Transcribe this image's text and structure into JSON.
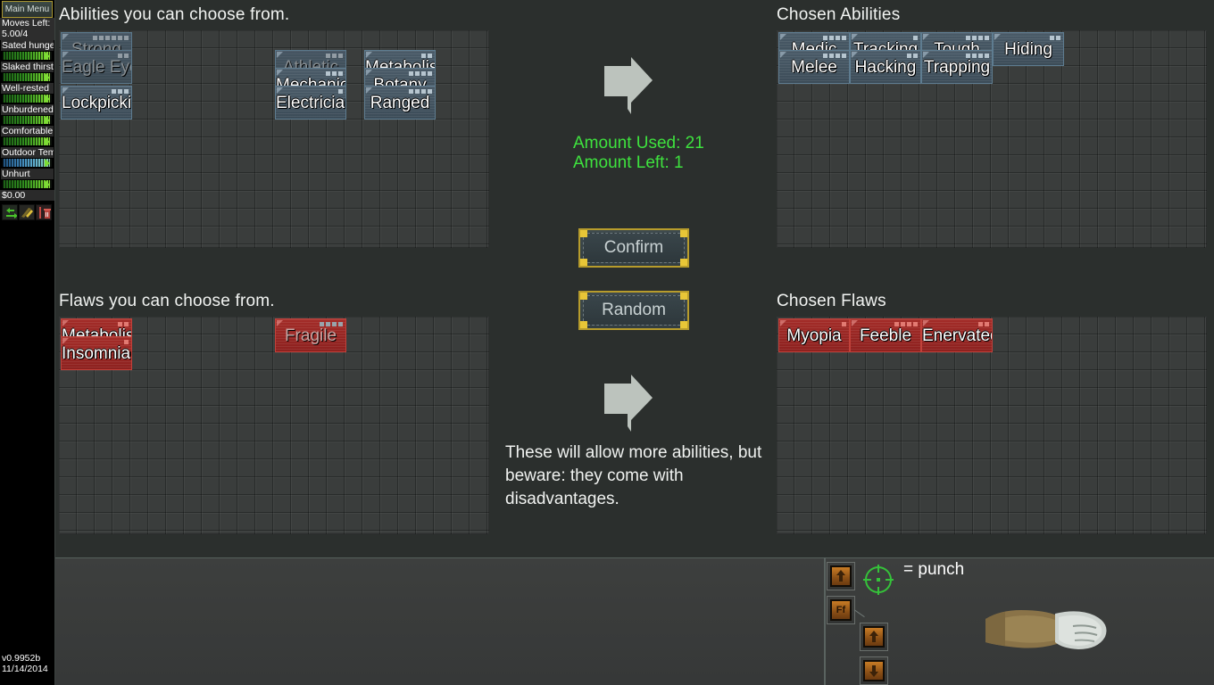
{
  "sidebar": {
    "menu_button": "Main Menu",
    "moves_label": "Moves Left:",
    "moves_value": "5.00/4",
    "stats": [
      {
        "label": "Sated hunge",
        "fill": 96,
        "type": "green"
      },
      {
        "label": "Slaked thirst",
        "fill": 96,
        "type": "green"
      },
      {
        "label": "Well-rested",
        "fill": 96,
        "type": "green"
      },
      {
        "label": "Unburdened",
        "fill": 96,
        "type": "green"
      },
      {
        "label": "Comfortable",
        "fill": 96,
        "type": "green"
      },
      {
        "label": "Outdoor Tem",
        "fill": 96,
        "type": "blue"
      },
      {
        "label": "Unhurt",
        "fill": 96,
        "type": "green"
      }
    ],
    "money": "$0.00",
    "icons": [
      "move-arrows-icon",
      "lightning-bolt-icon",
      "trash-can-icon"
    ],
    "version": "v0.9952b",
    "date": "11/14/2014"
  },
  "abilities_pool": {
    "heading": "Abilities you can choose from.",
    "items": [
      {
        "label": "Strong",
        "col": 0,
        "row": 0,
        "cost": 6,
        "disabled": true
      },
      {
        "label": "Eagle Eye",
        "col": 0,
        "row": 1,
        "cost": 2,
        "disabled": true
      },
      {
        "label": "Lockpicking",
        "col": 0,
        "row": 3,
        "cost": 3,
        "disabled": false
      },
      {
        "label": "Athletic",
        "col": 12,
        "row": 1,
        "cost": 3,
        "disabled": true
      },
      {
        "label": "Metabolism",
        "col": 17,
        "row": 1,
        "cost": 2,
        "disabled": false
      },
      {
        "label": "Mechanic",
        "col": 12,
        "row": 2,
        "cost": 3,
        "disabled": false
      },
      {
        "label": "Botany",
        "col": 17,
        "row": 2,
        "cost": 4,
        "disabled": false
      },
      {
        "label": "Electrician",
        "col": 12,
        "row": 3,
        "cost": 1,
        "disabled": false
      },
      {
        "label": "Ranged",
        "col": 17,
        "row": 3,
        "cost": 4,
        "disabled": false
      }
    ]
  },
  "flaws_pool": {
    "heading": "Flaws you can choose from.",
    "items": [
      {
        "label": "Metabolism",
        "col": 0,
        "row": 0,
        "cost": 2,
        "disabled": false
      },
      {
        "label": "Insomniac",
        "col": 0,
        "row": 1,
        "cost": 1,
        "disabled": false
      },
      {
        "label": "Fragile",
        "col": 12,
        "row": 0,
        "cost": 4,
        "disabled": true
      }
    ]
  },
  "chosen_abilities": {
    "heading": "Chosen Abilities",
    "items": [
      {
        "label": "Medic",
        "col": 0,
        "row": 0,
        "cost": 4
      },
      {
        "label": "Tracking",
        "col": 4,
        "row": 0,
        "cost": 1
      },
      {
        "label": "Tough",
        "col": 8,
        "row": 0,
        "cost": 4
      },
      {
        "label": "Hiding",
        "col": 12,
        "row": 0,
        "cost": 2
      },
      {
        "label": "Melee",
        "col": 0,
        "row": 1,
        "cost": 4
      },
      {
        "label": "Hacking",
        "col": 4,
        "row": 1,
        "cost": 2
      },
      {
        "label": "Trapping",
        "col": 8,
        "row": 1,
        "cost": 4
      }
    ]
  },
  "chosen_flaws": {
    "heading": "Chosen Flaws",
    "items": [
      {
        "label": "Myopia",
        "col": 0,
        "row": 0,
        "cost": 1
      },
      {
        "label": "Feeble",
        "col": 4,
        "row": 0,
        "cost": 4
      },
      {
        "label": "Enervated",
        "col": 8,
        "row": 0,
        "cost": 2
      }
    ]
  },
  "center": {
    "amount_used": "Amount Used: 21",
    "amount_left": "Amount Left: 1",
    "confirm_label": "Confirm",
    "random_label": "Random",
    "note": "These will allow more abilities, but beware: they come with disadvantages.",
    "arrow_top_icon": "arrow-right-icon",
    "arrow_bottom_icon": "arrow-right-icon"
  },
  "hud": {
    "punch_label": "= punch",
    "crosshair_icon": "crosshair-icon",
    "buttons_left": [
      "up-arrow-icon",
      "fast-forward-icon"
    ],
    "buttons_right": [
      "up-arrow-icon",
      "down-arrow-icon"
    ],
    "fast_forward_text": "Ff",
    "fist_icon": "fist-arm-icon"
  },
  "colors": {
    "ability": "#4a5b68",
    "flaw": "#a32c28",
    "amount_green": "#3ee23e",
    "button_gold": "#b79c2c",
    "crosshair_green": "#35c23a"
  }
}
